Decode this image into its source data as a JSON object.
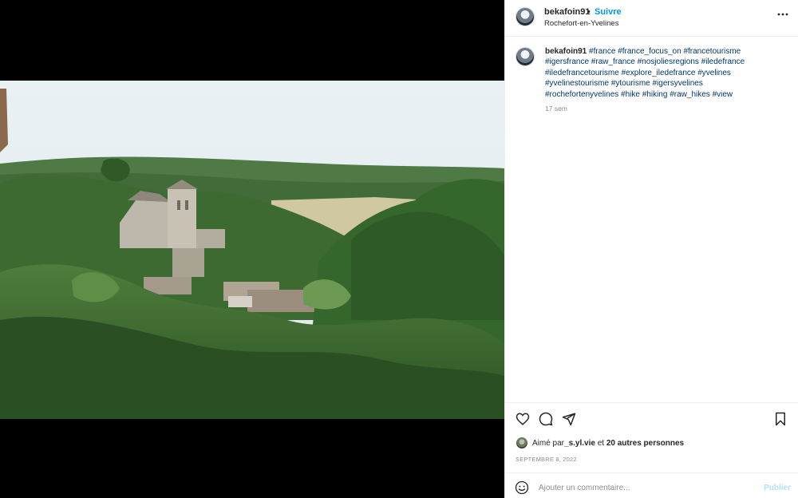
{
  "post": {
    "username": "bekafoin91",
    "separator": "•",
    "follow_label": "Suivre",
    "location": "Rochefort-en-Yvelines",
    "caption_username": "bekafoin91",
    "caption_tags": "#france #france_focus_on #francetourisme #igersfrance #raw_france #nosjoliesregions #iledefrance #iledefrancetourisme #explore_iledefrance #yvelines #yvelinestourisme #ytourisme #igersyvelines #rochefortenyvelines #hike #hiking #raw_hikes #view",
    "time_ago": "17 sem",
    "likes_prefix": "Aimé par ",
    "likes_user": "_s.yl.vie",
    "likes_middle": " et ",
    "likes_others": "20 autres personnes",
    "date": "SEPTEMBRE 8, 2022",
    "comment_placeholder": "Ajouter un commentaire...",
    "publish_label": "Publier"
  },
  "icons": {
    "more": "more-horizontal-icon",
    "like": "heart-icon",
    "comment": "comment-icon",
    "share": "share-icon",
    "save": "bookmark-icon",
    "emoji": "emoji-icon"
  },
  "colors": {
    "accent": "#0095f6",
    "hashtag": "#00376b",
    "muted": "#8e8e8e",
    "publish_disabled": "#b2dffc"
  }
}
